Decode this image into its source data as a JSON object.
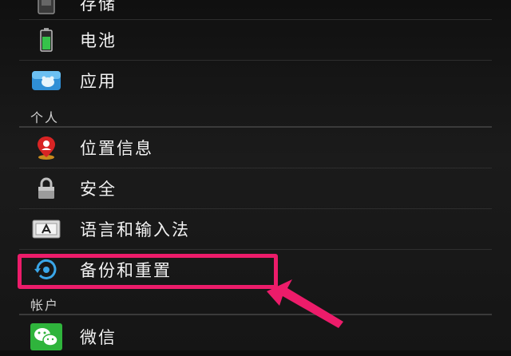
{
  "settings": {
    "items": [
      {
        "label": "存储",
        "icon": "storage-icon"
      },
      {
        "label": "电池",
        "icon": "battery-icon"
      },
      {
        "label": "应用",
        "icon": "apps-icon"
      }
    ],
    "sections": [
      {
        "title": "个人"
      },
      {
        "title": "帐户"
      }
    ],
    "personal": [
      {
        "label": "位置信息",
        "icon": "location-icon"
      },
      {
        "label": "安全",
        "icon": "lock-icon"
      },
      {
        "label": "语言和输入法",
        "icon": "keyboard-icon"
      },
      {
        "label": "备份和重置",
        "icon": "backup-reset-icon"
      }
    ],
    "accounts": [
      {
        "label": "微信",
        "icon": "wechat-icon"
      }
    ]
  },
  "annotation": {
    "highlight_color": "#ec1c6a"
  }
}
